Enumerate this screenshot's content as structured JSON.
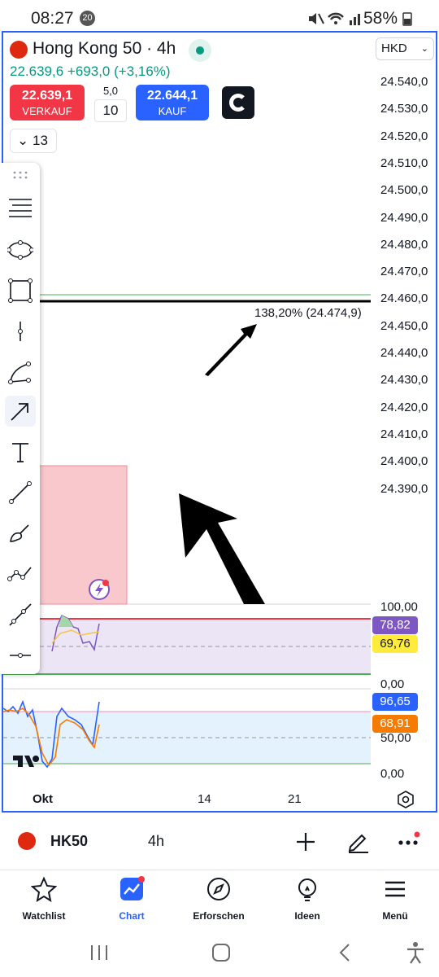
{
  "status": {
    "time": "08:27",
    "notifications": "20",
    "battery": "58%"
  },
  "header": {
    "title": "Hong Kong 50 · 4h",
    "price": "22.639,6",
    "change": "+693,0 (+3,16%)",
    "currency": "HKD"
  },
  "trade": {
    "sell_price": "22.639,1",
    "sell_label": "VERKAUF",
    "buy_price": "22.644,1",
    "buy_label": "KAUF",
    "spread": "5,0",
    "quantity": "10"
  },
  "drawings_count": "13",
  "price_axis": [
    "24.540,0",
    "24.530,0",
    "24.520,0",
    "24.510,0",
    "24.500,0",
    "24.490,0",
    "24.480,0",
    "24.470,0",
    "24.460,0",
    "24.450,0",
    "24.440,0",
    "24.430,0",
    "24.420,0",
    "24.410,0",
    "24.400,0",
    "24.390,0"
  ],
  "fib_label": "138,20% (24.474,9)",
  "rsi": {
    "axis_top": "100,00",
    "axis_bottom": "0,00",
    "value1": "78,82",
    "value2": "69,76"
  },
  "stoch": {
    "axis_mid": "50,00",
    "axis_bottom": "0,00",
    "value1": "96,65",
    "value2": "68,91"
  },
  "time_axis": [
    "Okt",
    "14",
    "21"
  ],
  "colors": {
    "accent": "#2962ff",
    "sell": "#f23645",
    "up": "#089981",
    "rsi_badge": "#7e57c2",
    "rsi_badge2": "#ffeb3b",
    "stoch_badge1": "#2962ff",
    "stoch_badge2": "#f57c00"
  },
  "symbol_bar": {
    "symbol": "HK50",
    "interval": "4h"
  },
  "nav": [
    {
      "label": "Watchlist",
      "icon": "star-icon"
    },
    {
      "label": "Chart",
      "icon": "chart-icon"
    },
    {
      "label": "Erforschen",
      "icon": "compass-icon"
    },
    {
      "label": "Ideen",
      "icon": "lightbulb-icon"
    },
    {
      "label": "Menü",
      "icon": "menu-icon"
    }
  ]
}
